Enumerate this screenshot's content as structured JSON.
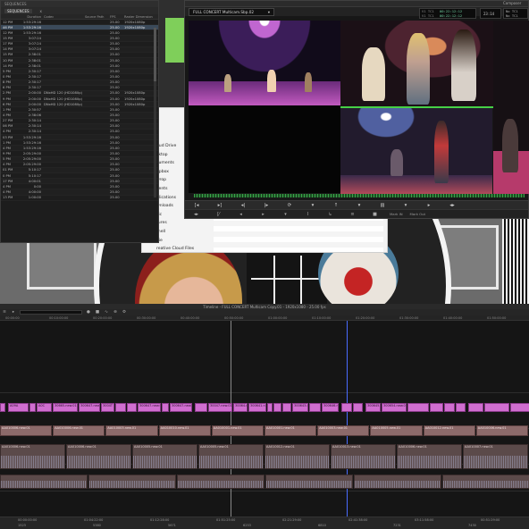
{
  "sequences_panel": {
    "title": "SEQUENCES",
    "tabs": [
      "SEQUENCES",
      "x"
    ],
    "columns": [
      "",
      "Duration",
      "Codec",
      "Source Path",
      "FPS",
      "Raster Dimension"
    ],
    "rows": [
      {
        "time": "12 PM",
        "dur": "1:53:29:16",
        "codec": "",
        "fps": "25.00",
        "raster": "1920x1080p"
      },
      {
        "time": "46 PM",
        "dur": "1:53:29:16",
        "codec": "",
        "fps": "25.00",
        "raster": "1920x1080p",
        "selected": true
      },
      {
        "time": "12 PM",
        "dur": "1:53:29:16",
        "codec": "",
        "fps": "25.00",
        "raster": ""
      },
      {
        "time": "15 PM",
        "dur": "3:07:24",
        "codec": "",
        "fps": "25.00",
        "raster": ""
      },
      {
        "time": "17 PM",
        "dur": "3:07:24",
        "codec": "",
        "fps": "25.00",
        "raster": ""
      },
      {
        "time": "14 PM",
        "dur": "3:07:24",
        "codec": "",
        "fps": "25.00",
        "raster": ""
      },
      {
        "time": "15 PM",
        "dur": "2:38:01",
        "codec": "",
        "fps": "25.00",
        "raster": ""
      },
      {
        "time": "10 PM",
        "dur": "2:38:01",
        "codec": "",
        "fps": "25.00",
        "raster": ""
      },
      {
        "time": "14 PM",
        "dur": "2:38:01",
        "codec": "",
        "fps": "25.00",
        "raster": ""
      },
      {
        "time": "5 PM",
        "dur": "2:30:17",
        "codec": "",
        "fps": "25.00",
        "raster": ""
      },
      {
        "time": "0 PM",
        "dur": "2:30:17",
        "codec": "",
        "fps": "25.00",
        "raster": ""
      },
      {
        "time": "8 PM",
        "dur": "2:30:17",
        "codec": "",
        "fps": "25.00",
        "raster": ""
      },
      {
        "time": "6 PM",
        "dur": "2:30:17",
        "codec": "",
        "fps": "25.00",
        "raster": ""
      },
      {
        "time": "2 PM",
        "dur": "2:00:00",
        "codec": "DNxHD 120 (HD1080p)",
        "fps": "25.00",
        "raster": "1920x1080p"
      },
      {
        "time": "9 PM",
        "dur": "2:00:00",
        "codec": "DNxHD 120 (HD1080p)",
        "fps": "25.00",
        "raster": "1920x1080p"
      },
      {
        "time": "6 PM",
        "dur": "2:00:00",
        "codec": "DNxHD 120 (HD1080p)",
        "fps": "25.00",
        "raster": "1920x1080p"
      },
      {
        "time": "1 PM",
        "dur": "2:30:57",
        "codec": "",
        "fps": "25.00",
        "raster": ""
      },
      {
        "time": "4 PM",
        "dur": "2:38:06",
        "codec": "",
        "fps": "25.00",
        "raster": ""
      },
      {
        "time": "27 PM",
        "dur": "2:30:14",
        "codec": "",
        "fps": "25.00",
        "raster": ""
      },
      {
        "time": "06 PM",
        "dur": "2:30:14",
        "codec": "",
        "fps": "25.00",
        "raster": ""
      },
      {
        "time": "4 PM",
        "dur": "2:30:14",
        "codec": "",
        "fps": "25.00",
        "raster": ""
      },
      {
        "time": "03 PM",
        "dur": "1:53:29:16",
        "codec": "",
        "fps": "25.00",
        "raster": ""
      },
      {
        "time": "1 PM",
        "dur": "1:53:29:16",
        "codec": "",
        "fps": "25.00",
        "raster": ""
      },
      {
        "time": "4 PM",
        "dur": "1:53:29:16",
        "codec": "",
        "fps": "25.00",
        "raster": ""
      },
      {
        "time": "9 PM",
        "dur": "2:05:29:00",
        "codec": "",
        "fps": "25.00",
        "raster": ""
      },
      {
        "time": "5 PM",
        "dur": "2:05:29:00",
        "codec": "",
        "fps": "25.00",
        "raster": ""
      },
      {
        "time": "4 PM",
        "dur": "2:05:29:00",
        "codec": "",
        "fps": "25.00",
        "raster": ""
      },
      {
        "time": "01 PM",
        "dur": "5:10:17",
        "codec": "",
        "fps": "25.00",
        "raster": ""
      },
      {
        "time": "0 PM",
        "dur": "5:10:17",
        "codec": "",
        "fps": "25.00",
        "raster": ""
      },
      {
        "time": "17 PM",
        "dur": "4:00:01",
        "codec": "",
        "fps": "25.00",
        "raster": ""
      },
      {
        "time": "4 PM",
        "dur": "0:00",
        "codec": "",
        "fps": "25.00",
        "raster": ""
      },
      {
        "time": "4 PM",
        "dur": "4:00:00",
        "codec": "",
        "fps": "25.00",
        "raster": ""
      },
      {
        "time": "13 PM",
        "dur": "1:00:00",
        "codec": "",
        "fps": "25.00",
        "raster": ""
      }
    ]
  },
  "finder": {
    "items": [
      "oud Drive",
      "sktop",
      "cuments",
      "opbox",
      "Drop",
      "cents",
      "plications",
      "wnloads",
      "sic",
      "tures",
      "rnell",
      "vie",
      "reative Cloud Files"
    ]
  },
  "viewer": {
    "clip_name": "FULL CONCERT Multicam.Sbp.02",
    "title": "Composer",
    "timecodes": [
      {
        "label": "V1 TC1",
        "value": "00:22:12:12"
      },
      {
        "label": "V1 TC1",
        "value": "00:22:12:12"
      }
    ],
    "extra_tc": "23:14",
    "side_labels": [
      "No TC1",
      "No TC1"
    ],
    "controls_top": [
      "[◂",
      "▸]",
      "◂|",
      "|▸",
      "⟳",
      "▾",
      "↑",
      "▾",
      "▤",
      "▾",
      "▸",
      "◂▸"
    ],
    "controls_bottom": [
      "◂▸",
      "[⁄",
      "◂",
      "▸",
      "▾",
      "Ⅰ",
      "↳",
      "≡",
      "■",
      "Mark IN",
      "Mark Out"
    ],
    "bottom_labels": [
      "Mark In",
      "Mark Out"
    ]
  },
  "timeline": {
    "title": "Timeline - FULL CONCERT Multicam Copy.01 - 1920x1080 - 25.00 fps",
    "ruler_labels": [
      "00:00:00",
      "00:10:00:00",
      "00:20:00:00",
      "00:30:00:00",
      "00:40:00:00",
      "00:50:00:00",
      "01:00:00:00",
      "01:10:00:00",
      "01:20:00:00",
      "01:30:00:00",
      "01:40:00:00",
      "01:50:00:00"
    ],
    "video_clips": [
      "A",
      "AA",
      "AA",
      "AA",
      "AA",
      "AA",
      "AA",
      "AA",
      "AA",
      "AA",
      "AA",
      "AA",
      "AA",
      "AA",
      "AA",
      "AA",
      "AA",
      "AA",
      "AA",
      "AA",
      "AA",
      "AA",
      "AA",
      "AA",
      "AA",
      "AA",
      "AA",
      "AA",
      "AA",
      "AA",
      "AA",
      "AA",
      "AA",
      "AA",
      "AA",
      "AA",
      "AA",
      "AA",
      "AA",
      "AA",
      "AA",
      "AA",
      "AA",
      "AA",
      "AA",
      "AA",
      "AA",
      "AA",
      "AA",
      "AA",
      "AA",
      "AA",
      "AA",
      "AA",
      "AA",
      "AA",
      "AA",
      "AA",
      "AA",
      "AA",
      "AA",
      "AA",
      "AA",
      "AA",
      "AA"
    ],
    "video_labels": [
      "A09A",
      "A0C",
      "30665.new.01",
      "300647.new.01",
      "3004T",
      "300647.new.03",
      "300647.new.0",
      "30047.new.01",
      "30064.new.02",
      "300641.new.02",
      "300643.new.02",
      "300646.new.02",
      "300645.new.02",
      "300654.new.02"
    ],
    "audio1_labels": [
      "AA010006.new.01",
      "AA010006.new.01",
      "AA010003.new.01",
      "AA010010.new.01",
      "AA010001.new.01",
      "AA010001.new.01",
      "AA010003.new.01",
      "AA010005.new.01",
      "AA010012.new.01",
      "AA010006.new.01"
    ],
    "audio2_labels": [
      "AA010006.new.01",
      "AA010006.new.01",
      "AA010005.new.01",
      "AA010005.new.01",
      "AA010012.new.01",
      "AA010013.new.01",
      "AA010006.new.01",
      "AA010007.new.01"
    ],
    "bottom_labels": [
      "00:00:00:00",
      "01:04:22:00",
      "01:12:28:00",
      "01:51:25:00",
      "02:21:29:00",
      "02:41:38:00",
      "03:11:58:00",
      "00:51:29:00"
    ],
    "bottom_labels2": [
      "1523",
      "5380",
      "5671",
      "6253",
      "6810",
      "7231",
      "7430"
    ]
  }
}
